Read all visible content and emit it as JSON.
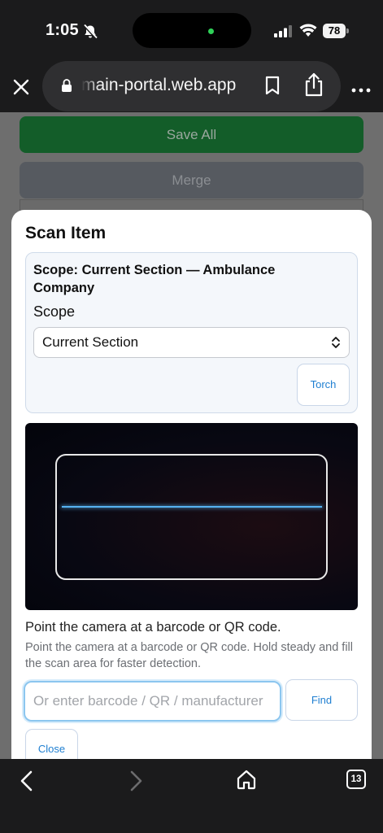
{
  "status_bar": {
    "time": "1:05",
    "battery": "78"
  },
  "browser": {
    "url": "main-portal.web.app",
    "tab_count": "13"
  },
  "background_page": {
    "save_all_label": "Save All",
    "merge_label": "Merge"
  },
  "modal": {
    "title": "Scan Item",
    "scope_heading": "Scope: Current Section — Ambulance Company",
    "scope_label": "Scope",
    "scope_selected": "Current Section",
    "torch_label": "Torch",
    "hint_main": "Point the camera at a barcode or QR code.",
    "hint_sub": "Point the camera at a barcode or QR code. Hold steady and fill the scan area for faster detection.",
    "input_placeholder": "Or enter barcode / QR / manufacturer",
    "input_value": "",
    "find_label": "Find",
    "close_label": "Close"
  },
  "colors": {
    "save_green": "#135d29",
    "accent_blue": "#1f7fd1",
    "scan_line": "#56b2f2"
  },
  "icons": [
    "bell-off-icon",
    "signal-icon",
    "wifi-icon",
    "battery-icon",
    "close-icon",
    "lock-icon",
    "bookmark-icon",
    "share-icon",
    "more-icon",
    "chevron-updown-icon",
    "back-icon",
    "forward-icon",
    "home-icon",
    "tabs-icon"
  ]
}
